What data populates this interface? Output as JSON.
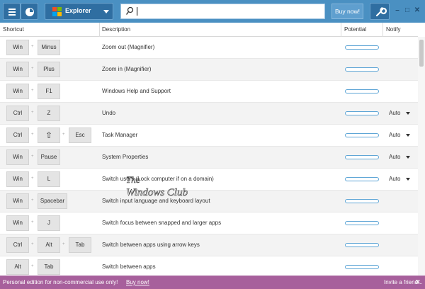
{
  "toolbar": {
    "explorer_label": "Explorer",
    "search": {
      "value": "",
      "placeholder": ""
    },
    "buy_label": "Buy now!",
    "window_controls": [
      "–",
      "□",
      "✕"
    ]
  },
  "columns": {
    "shortcut": "Shortcut",
    "description": "Description",
    "potential": "Potential",
    "notify": "Notify"
  },
  "rows": [
    {
      "keys": [
        "Win",
        "Minus"
      ],
      "description": "Zoom out (Magnifier)",
      "notify": ""
    },
    {
      "keys": [
        "Win",
        "Plus"
      ],
      "description": "Zoom in (Magnifier)",
      "notify": ""
    },
    {
      "keys": [
        "Win",
        "F1"
      ],
      "description": "Windows Help and Support",
      "notify": ""
    },
    {
      "keys": [
        "Ctrl",
        "Z"
      ],
      "description": "Undo",
      "notify": "Auto"
    },
    {
      "keys": [
        "Ctrl",
        "⇧",
        "Esc"
      ],
      "description": "Task Manager",
      "notify": "Auto"
    },
    {
      "keys": [
        "Win",
        "Pause"
      ],
      "description": "System Properties",
      "notify": "Auto"
    },
    {
      "keys": [
        "Win",
        "L"
      ],
      "description": "Switch users (Lock computer if on a domain)",
      "notify": "Auto"
    },
    {
      "keys": [
        "Win",
        "Spacebar"
      ],
      "description": "Switch input language and keyboard layout",
      "notify": ""
    },
    {
      "keys": [
        "Win",
        "J"
      ],
      "description": "Switch focus between snapped and larger apps",
      "notify": ""
    },
    {
      "keys": [
        "Ctrl",
        "Alt",
        "Tab"
      ],
      "description": "Switch between apps using arrow keys",
      "notify": ""
    },
    {
      "keys": [
        "Alt",
        "Tab"
      ],
      "description": "Switch between apps",
      "notify": ""
    }
  ],
  "footer": {
    "text": "Personal edition for non-commercial use only!",
    "buy_link": "Buy now!",
    "invite": "Invite a friend...",
    "close": "✕"
  },
  "watermark": {
    "line1": "The",
    "line2": "Windows Club"
  },
  "colors": {
    "titlebar": "#4a90c2",
    "footer": "#a7609c",
    "potential_bar": "#5fa6d6"
  },
  "icons": [
    "menu-icon",
    "clock-icon",
    "windows-logo-icon",
    "chevron-down-icon",
    "search-icon",
    "wrench-icon",
    "minimize-icon",
    "maximize-icon",
    "close-icon"
  ]
}
